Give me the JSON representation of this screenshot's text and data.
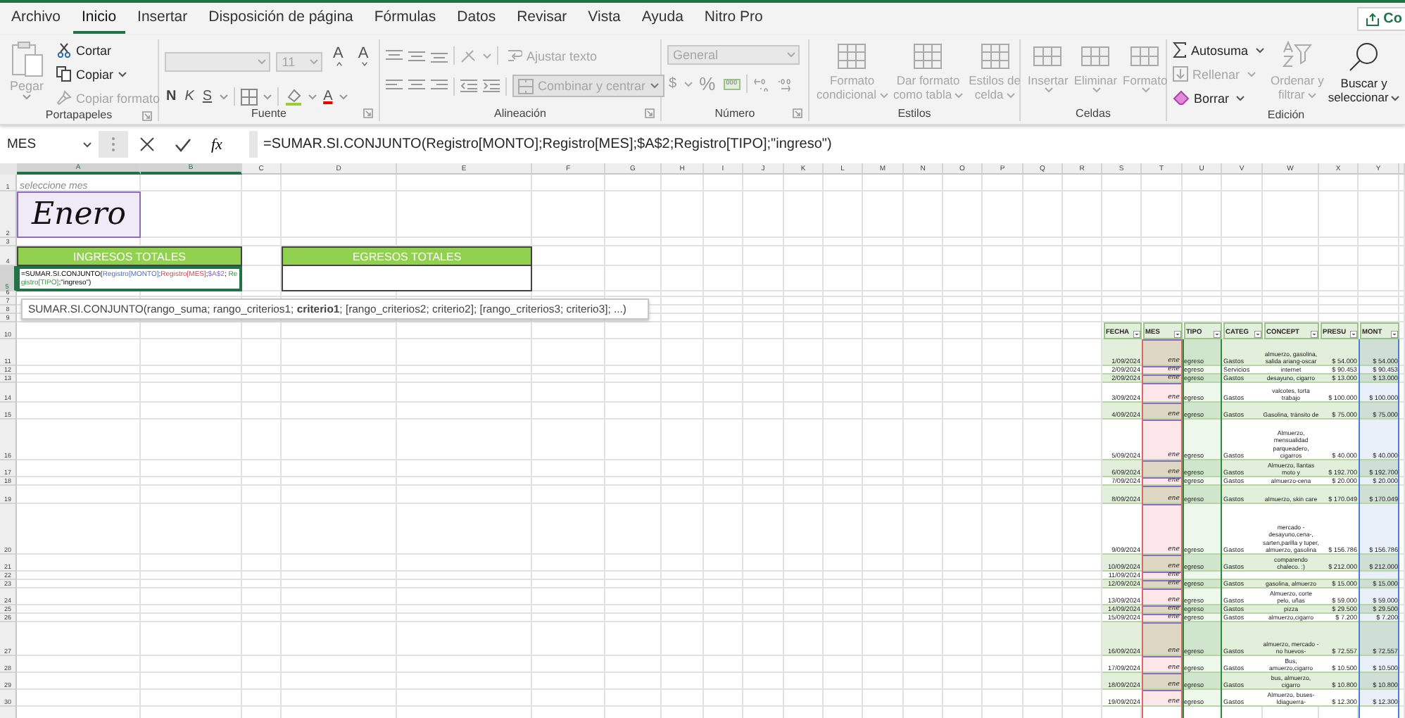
{
  "ribbon_tabs": [
    {
      "label": "Archivo",
      "selected": false
    },
    {
      "label": "Inicio",
      "selected": true
    },
    {
      "label": "Insertar",
      "selected": false
    },
    {
      "label": "Disposición de página",
      "selected": false
    },
    {
      "label": "Fórmulas",
      "selected": false
    },
    {
      "label": "Datos",
      "selected": false
    },
    {
      "label": "Revisar",
      "selected": false
    },
    {
      "label": "Vista",
      "selected": false
    },
    {
      "label": "Ayuda",
      "selected": false
    },
    {
      "label": "Nitro Pro",
      "selected": false
    }
  ],
  "share_button": {
    "label": "Co"
  },
  "clipboard": {
    "label": "Portapapeles",
    "paste": {
      "label": "Pegar",
      "disabled": true
    },
    "cut": {
      "label": "Cortar",
      "disabled": false
    },
    "copy": {
      "label": "Copiar",
      "disabled": false
    },
    "format_painter": {
      "label": "Copiar formato",
      "disabled": true
    }
  },
  "font": {
    "label": "Fuente",
    "boxes_disabled": true,
    "font_size": "11",
    "grow": "A",
    "shrink": "A",
    "bold": "N",
    "italic": "K",
    "underline": "S",
    "font_color": "A"
  },
  "alignment": {
    "label": "Alineación",
    "wrap_text": {
      "label": "Ajustar texto",
      "disabled": true
    },
    "merge": {
      "label": "Combinar y centrar",
      "disabled": true
    }
  },
  "number": {
    "label": "Número",
    "format": {
      "value": "General",
      "disabled": true
    },
    "currency": "$",
    "percent": "%",
    "thousands": "000"
  },
  "styles": {
    "label": "Estilos",
    "buttons": [
      {
        "lines": [
          "Formato",
          "condicional"
        ],
        "disabled": true
      },
      {
        "lines": [
          "Dar formato",
          "como tabla"
        ],
        "disabled": true
      },
      {
        "lines": [
          "Estilos de",
          "celda"
        ],
        "disabled": true
      }
    ]
  },
  "cells": {
    "label": "Celdas",
    "buttons": [
      {
        "label": "Insertar",
        "disabled": true
      },
      {
        "label": "Eliminar",
        "disabled": true
      },
      {
        "label": "Formato",
        "disabled": true
      }
    ]
  },
  "editing": {
    "label": "Edición",
    "autosum": {
      "label": "Autosuma",
      "disabled": false
    },
    "fill": {
      "label": "Rellenar",
      "disabled": true
    },
    "clear": {
      "label": "Borrar",
      "disabled": false
    },
    "sort": {
      "lines": [
        "Ordenar y",
        "filtrar"
      ],
      "disabled": true
    },
    "find": {
      "lines": [
        "Buscar y",
        "seleccionar"
      ],
      "disabled": false
    }
  },
  "formula_bar": {
    "name_box": "MES",
    "insert_function": "fx",
    "formula": "=SUMAR.SI.CONJUNTO(Registro[MONTO];Registro[MES];$A$2;Registro[TIPO];\"ingreso\")"
  },
  "sheet": {
    "columns": [
      {
        "label": "A",
        "selected": true
      },
      {
        "label": "B",
        "selected": true
      },
      {
        "label": "C",
        "selected": false
      },
      {
        "label": "D",
        "selected": false
      },
      {
        "label": "E",
        "selected": false
      },
      {
        "label": "F",
        "selected": false
      },
      {
        "label": "G",
        "selected": false
      },
      {
        "label": "H",
        "selected": false
      },
      {
        "label": "I",
        "selected": false
      },
      {
        "label": "J",
        "selected": false
      },
      {
        "label": "K",
        "selected": false
      },
      {
        "label": "L",
        "selected": false
      },
      {
        "label": "M",
        "selected": false
      },
      {
        "label": "N",
        "selected": false
      },
      {
        "label": "O",
        "selected": false
      },
      {
        "label": "P",
        "selected": false
      },
      {
        "label": "Q",
        "selected": false
      },
      {
        "label": "R",
        "selected": false
      },
      {
        "label": "S",
        "selected": false
      },
      {
        "label": "T",
        "selected": false
      },
      {
        "label": "U",
        "selected": false
      },
      {
        "label": "V",
        "selected": false
      },
      {
        "label": "W",
        "selected": false
      },
      {
        "label": "X",
        "selected": false
      },
      {
        "label": "Y",
        "selected": false
      }
    ],
    "rows": [
      {
        "label": "1",
        "selected": false
      },
      {
        "label": "2",
        "selected": false
      },
      {
        "label": "3",
        "selected": false
      },
      {
        "label": "4",
        "selected": false
      },
      {
        "label": "5",
        "selected": true
      },
      {
        "label": "6",
        "selected": false
      },
      {
        "label": "7",
        "selected": false
      },
      {
        "label": "8",
        "selected": false
      },
      {
        "label": "9",
        "selected": false
      },
      {
        "label": "10",
        "selected": false
      },
      {
        "label": "11",
        "selected": false
      },
      {
        "label": "12",
        "selected": false
      },
      {
        "label": "13",
        "selected": false
      },
      {
        "label": "14",
        "selected": false
      },
      {
        "label": "15",
        "selected": false
      },
      {
        "label": "16",
        "selected": false
      },
      {
        "label": "17",
        "selected": false
      },
      {
        "label": "18",
        "selected": false
      },
      {
        "label": "19",
        "selected": false
      },
      {
        "label": "20",
        "selected": false
      },
      {
        "label": "21",
        "selected": false
      },
      {
        "label": "22",
        "selected": false
      },
      {
        "label": "23",
        "selected": false
      },
      {
        "label": "24",
        "selected": false
      },
      {
        "label": "25",
        "selected": false
      },
      {
        "label": "26",
        "selected": false
      },
      {
        "label": "27",
        "selected": false
      },
      {
        "label": "28",
        "selected": false
      },
      {
        "label": "29",
        "selected": false
      },
      {
        "label": "30",
        "selected": false
      }
    ],
    "month_hint": "seleccione mes",
    "month_value": "Enero",
    "income_title": "INGRESOS TOTALES",
    "expense_title": "EGRESOS TOTALES",
    "income_formula": [
      {
        "text": "=SUMAR.SI.CONJUNTO(",
        "kind": "plain"
      },
      {
        "text": "Registro[MONTO]",
        "kind": "reference"
      },
      {
        "text": ";",
        "kind": "plain"
      },
      {
        "text": "Registro[MES]",
        "kind": "reference"
      },
      {
        "text": ";",
        "kind": "plain"
      },
      {
        "text": "$A$2",
        "kind": "reference"
      },
      {
        "text": "; ",
        "kind": "plain"
      },
      {
        "text": "Registro[TIPO]",
        "kind": "reference"
      },
      {
        "text": ";\"ingreso\")",
        "kind": "plain"
      }
    ],
    "function_tooltip": "SUMAR.SI.CONJUNTO(rango_suma; rango_criterios1; **criterio1**; [rango_criterios2; criterio2]; [rango_criterios3; criterio3]; ...)"
  },
  "registro_table": {
    "columns": [
      "FECHA",
      "MES",
      "TIPO",
      "CATEG",
      "CONCEPT",
      "PRESU",
      "MONT"
    ],
    "rows": [
      {
        "fecha": "1/09/2024",
        "mes": "ene",
        "tipo": "egreso",
        "categoria": "Gastos",
        "concepto": "almuerzo, gasolina, salida ariang-oscar",
        "presupuesto": "$ 54.000",
        "monto": "$ 54.000"
      },
      {
        "fecha": "2/09/2024",
        "mes": "ene",
        "tipo": "egreso",
        "categoria": "Servicios",
        "concepto": "internet",
        "presupuesto": "$ 90.453",
        "monto": "$ 90.453"
      },
      {
        "fecha": "2/09/2024",
        "mes": "ene",
        "tipo": "egreso",
        "categoria": "Gastos",
        "concepto": "desayuno, cigarro",
        "presupuesto": "$ 13.000",
        "monto": "$ 13.000"
      },
      {
        "fecha": "3/09/2024",
        "mes": "ene",
        "tipo": "egreso",
        "categoria": "Gastos",
        "concepto": "valcotes, torta trabajo",
        "presupuesto": "$ 100.000",
        "monto": "$ 100.000"
      },
      {
        "fecha": "4/09/2024",
        "mes": "ene",
        "tipo": "egreso",
        "categoria": "Gastos",
        "concepto": "Gasolina, tránsito de",
        "presupuesto": "$ 75.000",
        "monto": "$ 75.000"
      },
      {
        "fecha": "5/09/2024",
        "mes": "ene",
        "tipo": "egreso",
        "categoria": "Gastos",
        "concepto": "Almuerzo, mensualidad parqueadero, cigarros",
        "presupuesto": "$ 40.000",
        "monto": "$ 40.000"
      },
      {
        "fecha": "6/09/2024",
        "mes": "ene",
        "tipo": "egreso",
        "categoria": "Gastos",
        "concepto": "Almuerzo, llantas moto y",
        "presupuesto": "$ 192.700",
        "monto": "$ 192.700"
      },
      {
        "fecha": "7/09/2024",
        "mes": "ene",
        "tipo": "egreso",
        "categoria": "Gastos",
        "concepto": "almuerzo-cena",
        "presupuesto": "$ 20.000",
        "monto": "$ 20.000"
      },
      {
        "fecha": "8/09/2024",
        "mes": "ene",
        "tipo": "egreso",
        "categoria": "Gastos",
        "concepto": "almuerzo, skin care",
        "presupuesto": "$ 170.049",
        "monto": "$ 170.049"
      },
      {
        "fecha": "9/09/2024",
        "mes": "ene",
        "tipo": "egreso",
        "categoria": "Gastos",
        "concepto": "mercado - desayuno,cena-, sarten,parilla y tuper, almuerzo, gasolina",
        "presupuesto": "$ 156.786",
        "monto": "$ 156.786"
      },
      {
        "fecha": "10/09/2024",
        "mes": "ene",
        "tipo": "egreso",
        "categoria": "Gastos",
        "concepto": "comparendo chaleco. :)",
        "presupuesto": "$ 212.000",
        "monto": "$ 212.000"
      },
      {
        "fecha": "11/09/2024",
        "mes": "ene"
      },
      {
        "fecha": "12/09/2024",
        "mes": "ene",
        "tipo": "egreso",
        "categoria": "Gastos",
        "concepto": "gasolina, almuerzo",
        "presupuesto": "$ 15.000",
        "monto": "$ 15.000"
      },
      {
        "fecha": "13/09/2024",
        "mes": "ene",
        "tipo": "egreso",
        "categoria": "Gastos",
        "concepto": "Almuerzo, corte pelo, uñas",
        "presupuesto": "$ 59.000",
        "monto": "$ 59.000"
      },
      {
        "fecha": "14/09/2024",
        "mes": "ene",
        "tipo": "egreso",
        "categoria": "Gastos",
        "concepto": "pizza",
        "presupuesto": "$ 29.500",
        "monto": "$ 29.500"
      },
      {
        "fecha": "15/09/2024",
        "mes": "ene",
        "tipo": "egreso",
        "categoria": "Gastos",
        "concepto": "almuerzo,cigarro",
        "presupuesto": "$ 7.200",
        "monto": "$ 7.200"
      },
      {
        "fecha": "16/09/2024",
        "mes": "ene",
        "tipo": "egreso",
        "categoria": "Gastos",
        "concepto": "almuerzo, mercado - no huevos-",
        "presupuesto": "$ 72.557",
        "monto": "$ 72.557"
      },
      {
        "fecha": "17/09/2024",
        "mes": "ene",
        "tipo": "egreso",
        "categoria": "Gastos",
        "concepto": "Bus, amuerzo,cigarro",
        "presupuesto": "$ 10.500",
        "monto": "$ 10.500"
      },
      {
        "fecha": "18/09/2024",
        "mes": "ene",
        "tipo": "egreso",
        "categoria": "Gastos",
        "concepto": "bus, almuerzo, cigarro",
        "presupuesto": "$ 10.800",
        "monto": "$ 10.800"
      },
      {
        "fecha": "19/09/2024",
        "mes": "ene",
        "tipo": "egreso",
        "categoria": "Gastos",
        "concepto": "Almuerzo, buses-Idiaguerra-",
        "presupuesto": "$ 12.300",
        "monto": "$ 12.300"
      }
    ]
  }
}
